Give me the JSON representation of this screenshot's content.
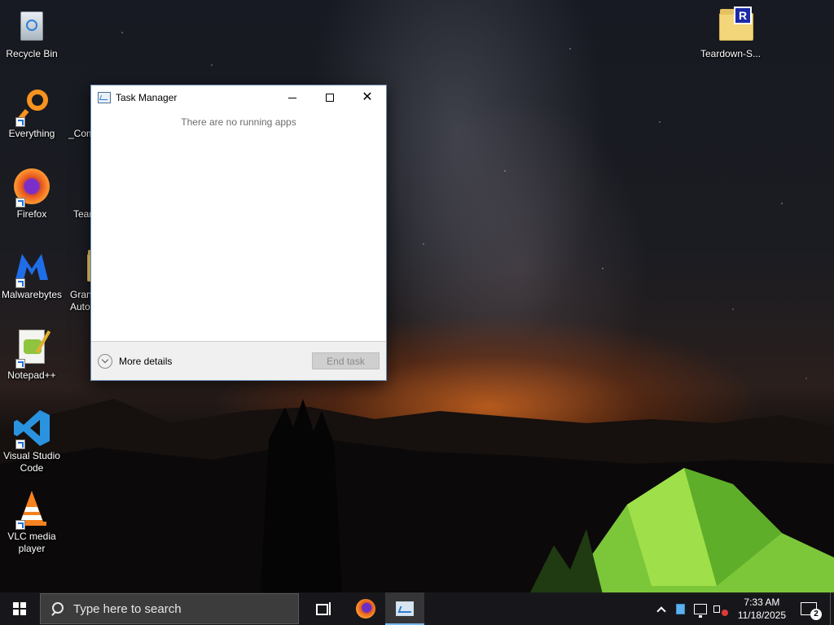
{
  "desktop": {
    "icons": [
      {
        "label": "Recycle Bin",
        "icon": "recycle-bin-icon"
      },
      {
        "label": "Everything",
        "icon": "everything-search-icon"
      },
      {
        "label": "Firefox",
        "icon": "firefox-icon"
      },
      {
        "label": "Malwarebytes",
        "icon": "malwarebytes-icon"
      },
      {
        "label": "Notepad++",
        "icon": "notepadpp-icon"
      },
      {
        "label": "Visual Studio Code",
        "icon": "vscode-icon"
      },
      {
        "label": "VLC media player",
        "icon": "vlc-icon"
      },
      {
        "label": "_Com",
        "icon": "folder-icon"
      },
      {
        "label": "Tear",
        "icon": "folder-icon"
      },
      {
        "label": "Gran Auto",
        "icon": "folder-icon"
      },
      {
        "label": "Teardown-S...",
        "icon": "folder-icon"
      }
    ]
  },
  "task_manager": {
    "title": "Task Manager",
    "empty_message": "There are no running apps",
    "more_details_label": "More details",
    "end_task_label": "End task"
  },
  "taskbar": {
    "search_placeholder": "Type here to search",
    "clock_time": "7:33 AM",
    "clock_date": "11/18/2025",
    "notification_count": "2"
  }
}
